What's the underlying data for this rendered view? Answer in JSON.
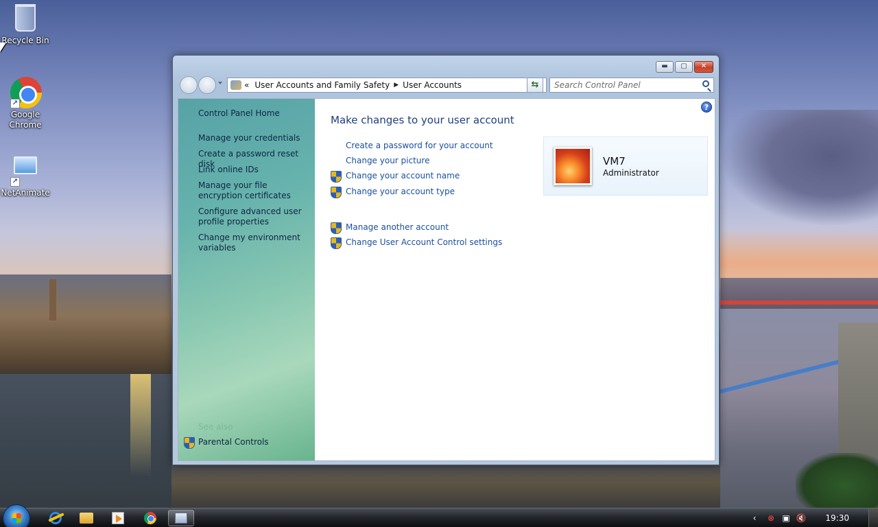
{
  "desktop": {
    "icons": [
      {
        "label": "Recycle Bin"
      },
      {
        "label": "Google Chrome"
      },
      {
        "label": "NetAnimate"
      }
    ]
  },
  "window": {
    "caption_buttons": {
      "minimize": "▬",
      "maximize": "▢",
      "close": "✕"
    },
    "address": {
      "overflow": "«",
      "crumbs": [
        "User Accounts and Family Safety",
        "User Accounts"
      ],
      "separator": "▶"
    },
    "refresh_symbol": "⇆",
    "search": {
      "placeholder": "Search Control Panel"
    },
    "help_symbol": "?"
  },
  "sidebar": {
    "home": "Control Panel Home",
    "links": [
      "Manage your credentials",
      "Create a password reset disk",
      "Link online IDs",
      "Manage your file encryption certificates",
      "Configure advanced user profile properties",
      "Change my environment variables"
    ],
    "see_also": "See also",
    "parental_controls": "Parental Controls"
  },
  "main": {
    "title": "Make changes to your user account",
    "tasks": [
      {
        "label": "Create a password for your account",
        "shield": false
      },
      {
        "label": "Change your picture",
        "shield": false
      },
      {
        "label": "Change your account name",
        "shield": true
      },
      {
        "label": "Change your account type",
        "shield": true
      }
    ],
    "other_tasks": [
      {
        "label": "Manage another account",
        "shield": true
      },
      {
        "label": "Change User Account Control settings",
        "shield": true
      }
    ],
    "user": {
      "name": "VM7",
      "role": "Administrator"
    }
  },
  "taskbar": {
    "pinned": [
      "internet-explorer-icon",
      "explorer-folder-icon",
      "media-player-icon",
      "chrome-icon",
      "control-panel-icon"
    ],
    "tray": {
      "chevron": "‹",
      "clock": "19:30"
    }
  }
}
